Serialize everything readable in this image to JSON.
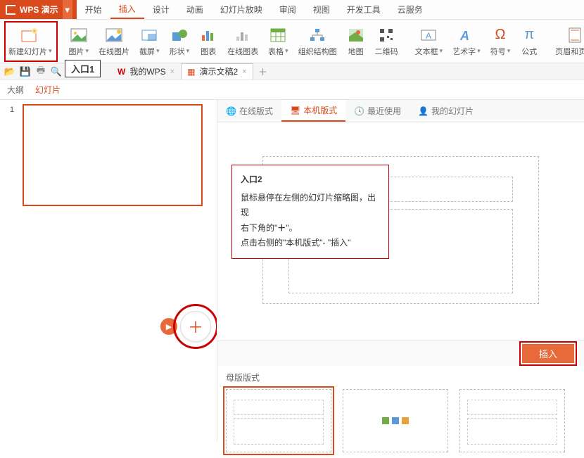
{
  "app": {
    "name": "WPS 演示"
  },
  "menu": {
    "items": [
      "开始",
      "插入",
      "设计",
      "动画",
      "幻灯片放映",
      "审阅",
      "视图",
      "开发工具",
      "云服务"
    ],
    "active": "插入"
  },
  "ribbon": {
    "new_slide": "新建幻灯片",
    "picture": "图片",
    "online_picture": "在线图片",
    "screenshot": "截屏",
    "shapes": "形状",
    "chart": "图表",
    "online_chart": "在线图表",
    "table": "表格",
    "org_chart": "组织结构图",
    "map": "地图",
    "qrcode": "二维码",
    "textbox": "文本框",
    "wordart": "艺术字",
    "symbol": "符号",
    "formula": "公式",
    "header_footer": "页眉和页脚"
  },
  "doctabs": {
    "wps_home": "我的WPS",
    "doc_name": "演示文稿2"
  },
  "outline": {
    "outline": "大纲",
    "slides": "幻灯片",
    "slide_number": "1"
  },
  "rtabs": {
    "online": "在线版式",
    "local": "本机版式",
    "recent": "最近使用",
    "mine": "我的幻灯片"
  },
  "callout": {
    "entry1": "入口1",
    "title": "入口2",
    "line1": "鼠标悬停在左侧的幻灯片缩略图，出现",
    "line2_a": "右下角的\"",
    "line2_b": "\"。",
    "plus": "＋",
    "line3": "点击右侧的\"本机版式\"- \"插入\""
  },
  "actions": {
    "insert": "插入"
  },
  "master": {
    "header": "母版版式"
  }
}
